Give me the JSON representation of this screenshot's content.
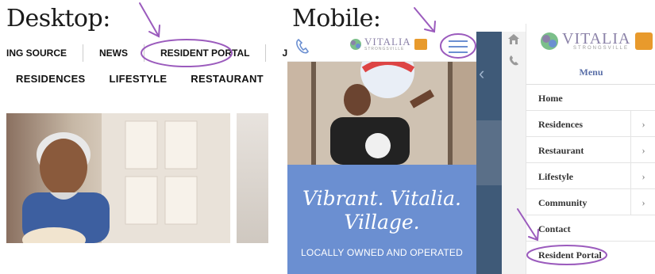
{
  "labels": {
    "desktop": "Desktop:",
    "mobile": "Mobile:"
  },
  "desktop": {
    "top_nav": [
      {
        "label": "ING SOURCE"
      },
      {
        "label": "NEWS"
      },
      {
        "label": "RESIDENT PORTAL",
        "highlighted": true
      },
      {
        "label": "JO"
      }
    ],
    "main_nav": [
      {
        "label": "RESIDENCES"
      },
      {
        "label": "LIFESTYLE"
      },
      {
        "label": "RESTAURANT"
      }
    ]
  },
  "mobile": {
    "logo": {
      "name": "VITALIA",
      "sub": "STRONGSVILLE"
    },
    "icons": [
      "phone-icon",
      "hamburger-menu-icon"
    ],
    "hero": {
      "line1": "Vibrant. Vitalia.",
      "line2": "Village.",
      "tagline": "LOCALLY OWNED AND OPERATED"
    }
  },
  "drawer": {
    "logo": {
      "name": "VITALIA",
      "sub": "STRONGSVILLE"
    },
    "icons": [
      "home-icon",
      "phone-icon"
    ],
    "title": "Menu",
    "items": [
      {
        "label": "Home",
        "has_submenu": false
      },
      {
        "label": "Residences",
        "has_submenu": true
      },
      {
        "label": "Restaurant",
        "has_submenu": true
      },
      {
        "label": "Lifestyle",
        "has_submenu": true
      },
      {
        "label": "Community",
        "has_submenu": true
      },
      {
        "label": "Contact",
        "has_submenu": false
      },
      {
        "label": "Resident Portal",
        "has_submenu": false,
        "highlighted": true
      }
    ]
  },
  "colors": {
    "annotation": "#9b5bbd",
    "hero_blue": "#6b8fd1",
    "menu_accent": "#5a6fa8"
  }
}
